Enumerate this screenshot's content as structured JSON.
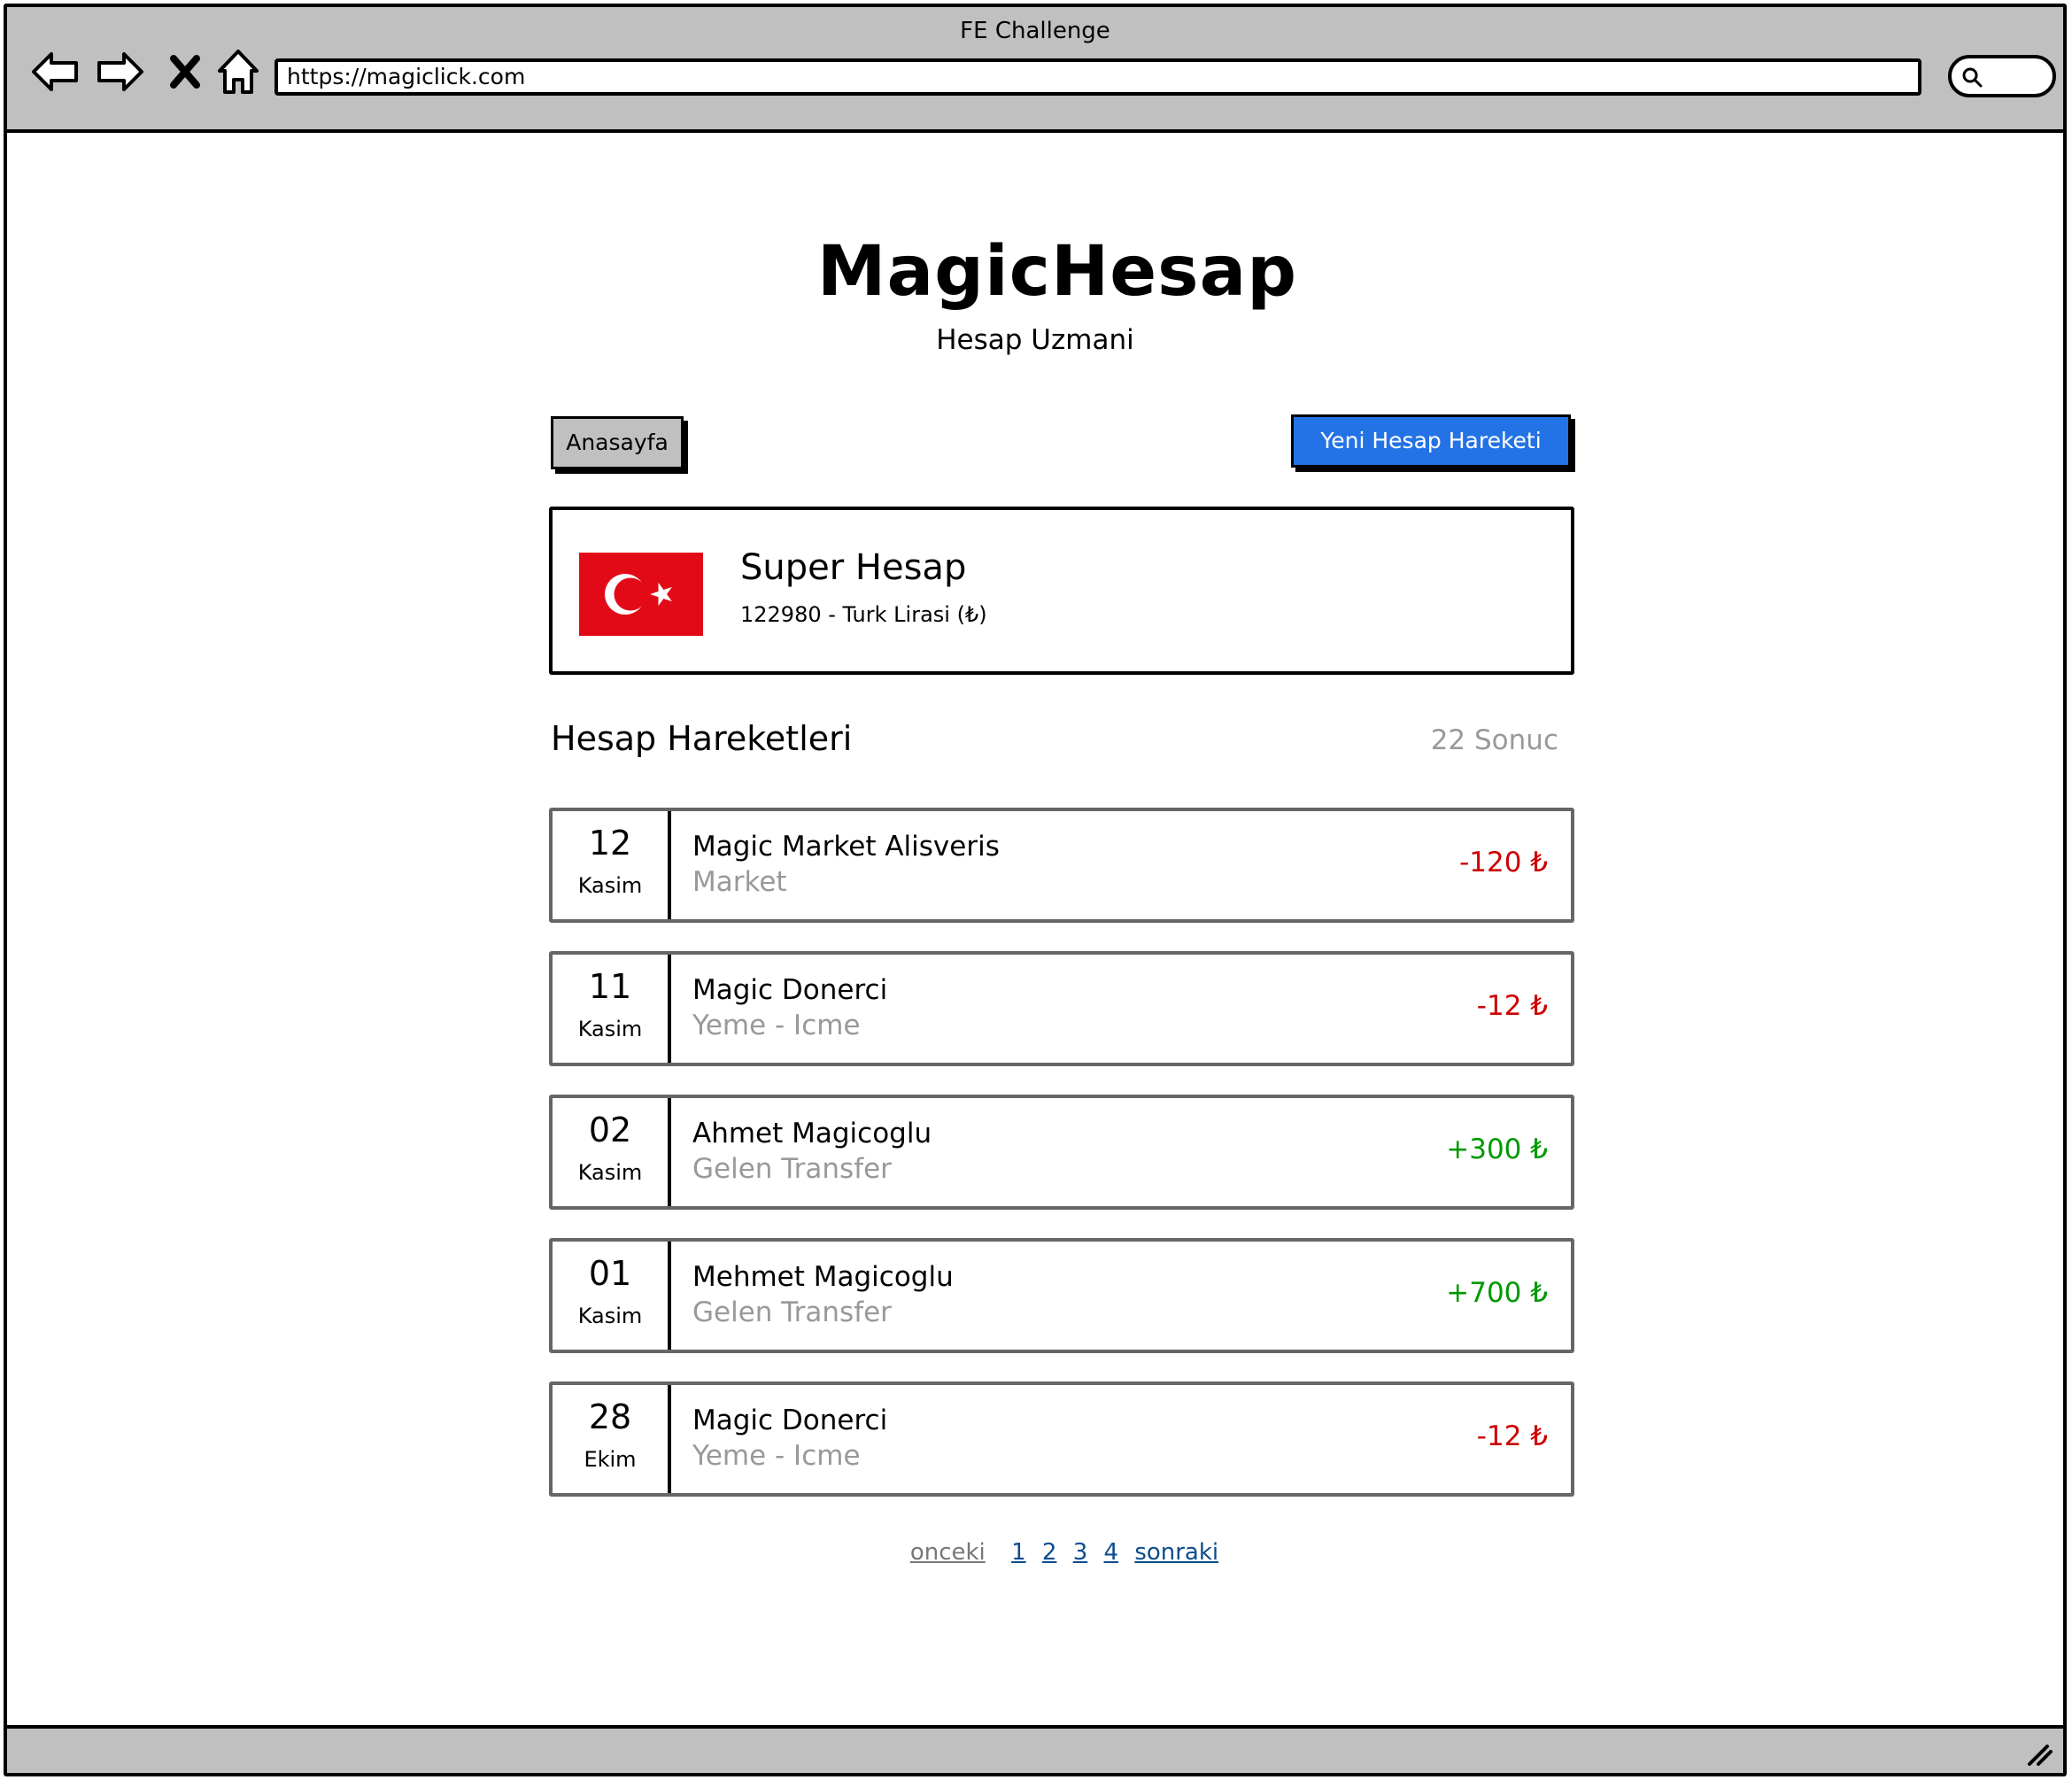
{
  "browser": {
    "window_title": "FE Challenge",
    "url": "https://magiclick.com",
    "nav_icons": [
      "back-arrow-icon",
      "forward-arrow-icon",
      "close-icon",
      "home-icon"
    ],
    "search_icon": "search-icon"
  },
  "header": {
    "title": "MagicHesap",
    "subtitle": "Hesap Uzmani"
  },
  "toolbar": {
    "home_label": "Anasayfa",
    "new_transaction_label": "Yeni Hesap Hareketi",
    "new_transaction_color": "#2473e6"
  },
  "account": {
    "name": "Super Hesap",
    "detail": "122980 - Turk Lirasi (₺)",
    "flag_icon": "turkey-flag-icon",
    "flag_color": "#e30a17"
  },
  "transactions": {
    "title": "Hesap Hareketleri",
    "count_label": "22 Sonuc",
    "items": [
      {
        "day": "12",
        "month": "Kasim",
        "name": "Magic Market Alisveris",
        "category": "Market",
        "amount": "-120 ₺",
        "direction": "negative"
      },
      {
        "day": "11",
        "month": "Kasim",
        "name": "Magic Donerci",
        "category": "Yeme - Icme",
        "amount": "-12 ₺",
        "direction": "negative"
      },
      {
        "day": "02",
        "month": "Kasim",
        "name": "Ahmet Magicoglu",
        "category": "Gelen Transfer",
        "amount": "+300 ₺",
        "direction": "positive"
      },
      {
        "day": "01",
        "month": "Kasim",
        "name": "Mehmet Magicoglu",
        "category": "Gelen Transfer",
        "amount": "+700 ₺",
        "direction": "positive"
      },
      {
        "day": "28",
        "month": "Ekim",
        "name": "Magic Donerci",
        "category": "Yeme - Icme",
        "amount": "-12 ₺",
        "direction": "negative"
      }
    ]
  },
  "pagination": {
    "prev_label": "onceki",
    "pages": [
      "1",
      "2",
      "3",
      "4"
    ],
    "next_label": "sonraki"
  },
  "colors": {
    "negative": "#cc0000",
    "positive": "#009900",
    "chrome": "#c0c0c0"
  }
}
